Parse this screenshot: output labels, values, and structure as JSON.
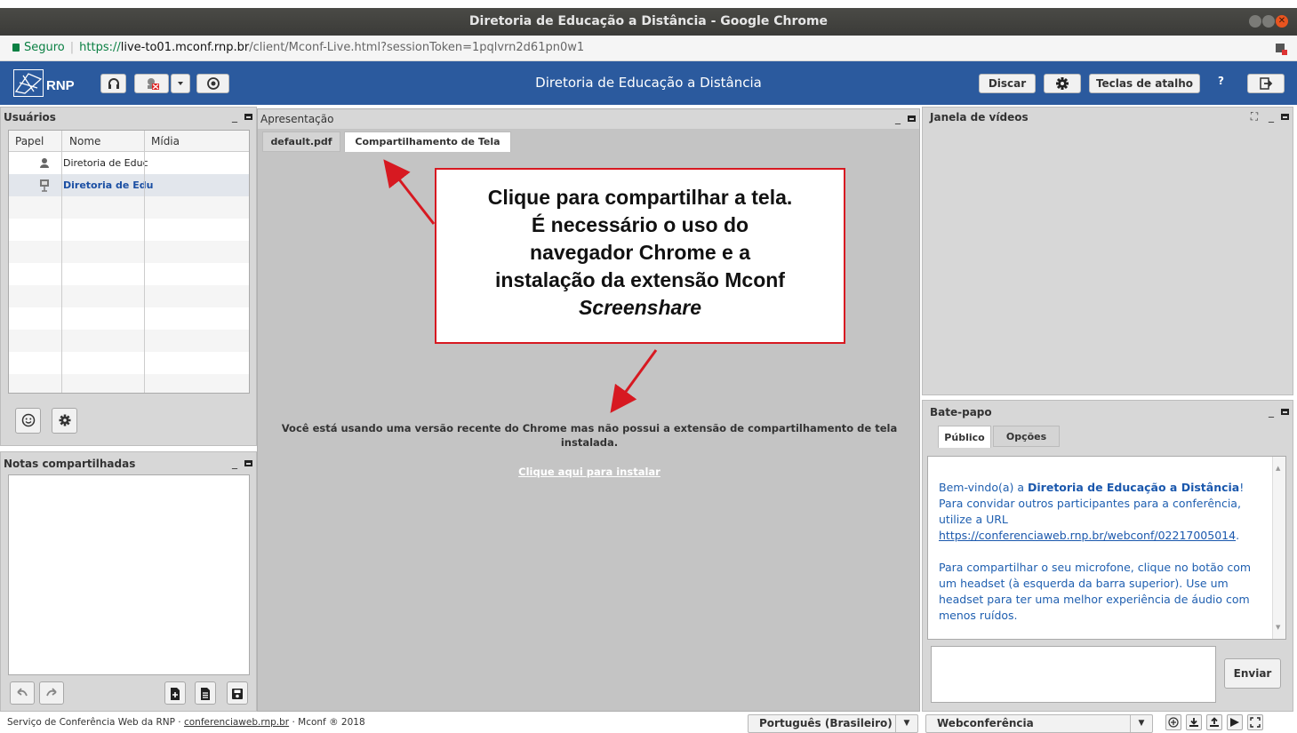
{
  "window": {
    "title": "Diretoria de Educação a Distância - Google Chrome"
  },
  "address": {
    "secure_label": "Seguro",
    "scheme": "https://",
    "host": "live-to01.mconf.rnp.br",
    "path": "/client/Mconf-Live.html?sessionToken=1pqlvrn2d61pn0w1"
  },
  "appbar": {
    "logo_text": "RNP",
    "title": "Diretoria de Educação a Distância",
    "discar_label": "Discar",
    "shortcuts_label": "Teclas de atalho",
    "help_label": "?"
  },
  "users": {
    "title": "Usuários",
    "columns": [
      "Papel",
      "Nome",
      "Mídia"
    ],
    "rows": [
      {
        "name": "Diretoria de Educ",
        "role_icon": "person-icon"
      },
      {
        "name": "Diretoria de Edu",
        "role_icon": "presenter-icon"
      }
    ]
  },
  "notes": {
    "title": "Notas compartilhadas"
  },
  "presentation": {
    "title": "Apresentação",
    "tabs": [
      "default.pdf",
      "Compartilhamento de Tela"
    ],
    "message": "Você está usando uma versão recente do Chrome mas não possui a extensão de compartilhamento de tela instalada.",
    "install_link": "Clique aqui para instalar"
  },
  "callout": {
    "line1": "Clique para compartilhar a tela.",
    "line2": "É necessário o uso do",
    "line3": "navegador Chrome e a",
    "line4": "instalação da extensão Mconf",
    "line5": "Screenshare"
  },
  "video": {
    "title": "Janela de vídeos",
    "ctrl_fullscreen": "⛶"
  },
  "chat": {
    "title": "Bate-papo",
    "tabs": [
      "Público",
      "Opções"
    ],
    "welcome_prefix": "Bem-vindo(a) a ",
    "welcome_room": "Diretoria de Educação a Distância",
    "welcome_suffix": "!",
    "invite_text": "Para convidar outros participantes para a conferência, utilize a URL",
    "invite_url": "https://conferenciaweb.rnp.br/webconf/02217005014",
    "invite_end": ".",
    "mic_text": "Para compartilhar o seu microfone, clique no botão com um headset (à esquerda da barra superior). Use um headset para ter uma melhor experiência de áudio com menos ruídos.",
    "send_label": "Enviar"
  },
  "footer": {
    "service_text": "Serviço de Conferência Web da RNP · ",
    "service_link": "conferenciaweb.rnp.br",
    "copyright": " · Mconf ® 2018",
    "language": "Português (Brasileiro)",
    "layout": "Webconferência"
  },
  "colors": {
    "appbar": "#2b5a9e",
    "callout_border": "#d71921",
    "chat_text": "#1f5fb0"
  }
}
